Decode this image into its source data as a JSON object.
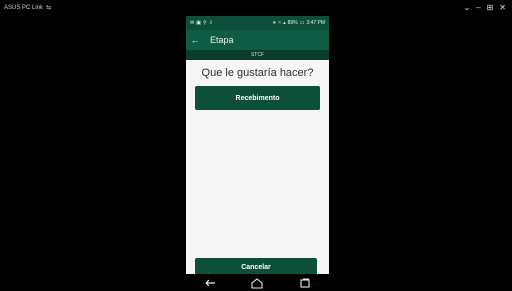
{
  "host": {
    "title": "ASUS PC Link",
    "link_glyph": "⇆",
    "controls": {
      "minimize": "⌄",
      "restore": "–",
      "grid": "⊞",
      "close": "✕"
    }
  },
  "phone": {
    "statusbar": {
      "battery": "89%",
      "time": "3:47 PM"
    },
    "appbar": {
      "back_glyph": "←",
      "title": "Etapa"
    },
    "subheader": "STCF",
    "question": "Que le gustaría hacer?",
    "primary_button": "Recebimento",
    "cancel_button": "Cancelar"
  },
  "colors": {
    "primary": "#0d4f3a",
    "appbar": "#0f5c44",
    "background": "#f6f6f6"
  }
}
